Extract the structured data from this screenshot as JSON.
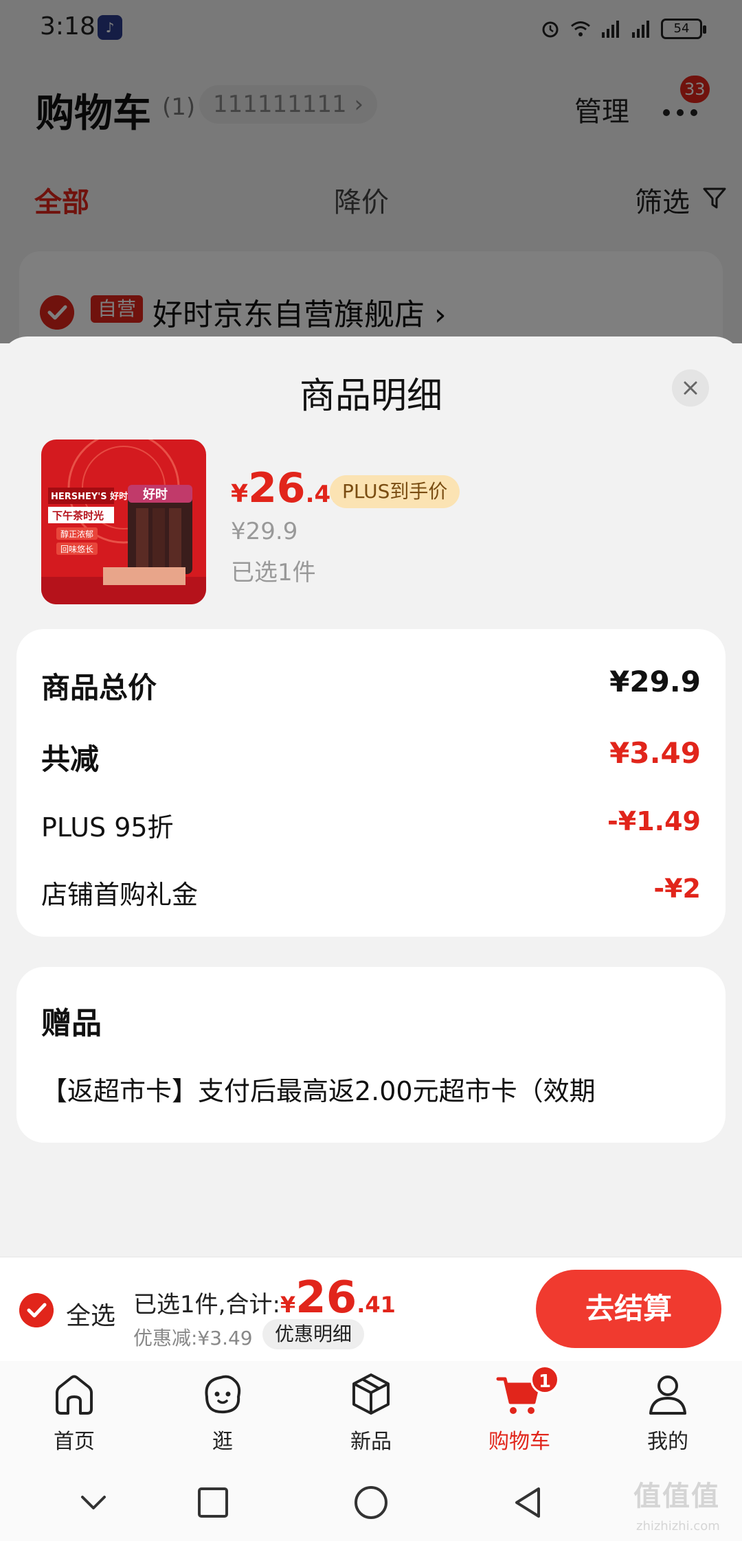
{
  "status_bar": {
    "time": "3:18",
    "app_icon_glyph": "♪",
    "battery": "54"
  },
  "cart_header": {
    "title": "购物车",
    "count": "(1)",
    "account": "111111111 ›",
    "manage": "管理",
    "more_badge": "33"
  },
  "cart_tabs": {
    "all": "全部",
    "price_drop": "降价",
    "filter": "筛选"
  },
  "store": {
    "self_tag": "自营",
    "name": "好时京东自营旗舰店 ›"
  },
  "sheet": {
    "title": "商品明细",
    "product": {
      "image_text": {
        "brand": "HERSHEY'S 好时",
        "tagline": "下午茶时光",
        "line1": "醇正浓郁",
        "line2": "回味悠长",
        "can_label": "好时"
      },
      "price_yen": "¥",
      "price_int": "26",
      "price_dec": ".41",
      "plus_tag": "PLUS到手价",
      "original_price": "¥29.9",
      "selected": "已选1件"
    },
    "summary": {
      "total_label": "商品总价",
      "total_value": "¥29.9",
      "reduce_label": "共减",
      "reduce_value": "¥3.49",
      "plus_label": "PLUS 95折",
      "plus_value": "-¥1.49",
      "coupon_label": "店铺首购礼金",
      "coupon_value": "-¥2"
    },
    "gift": {
      "title": "赠品",
      "text": "【返超市卡】支付后最高返2.00元超市卡（效期"
    }
  },
  "checkout": {
    "select_all": "全选",
    "summary_text": "已选1件,合计:",
    "total_yen": "¥",
    "total_int": "26",
    "total_dec": ".41",
    "discount": "优惠减:¥3.49",
    "detail_button": "优惠明细",
    "pay_button": "去结算"
  },
  "tabbar": {
    "items": [
      {
        "label": "首页",
        "icon": "home-icon"
      },
      {
        "label": "逛",
        "icon": "browse-face-icon"
      },
      {
        "label": "新品",
        "icon": "box-icon"
      },
      {
        "label": "购物车",
        "icon": "cart-icon",
        "badge": "1"
      },
      {
        "label": "我的",
        "icon": "person-icon"
      }
    ]
  },
  "watermark": {
    "main": "值值值",
    "sub": "zhizhizhi.com"
  },
  "colors": {
    "accent": "#e1251b",
    "plus_tag_bg": "#fbe3b3",
    "pay_button": "#f03a2f"
  }
}
